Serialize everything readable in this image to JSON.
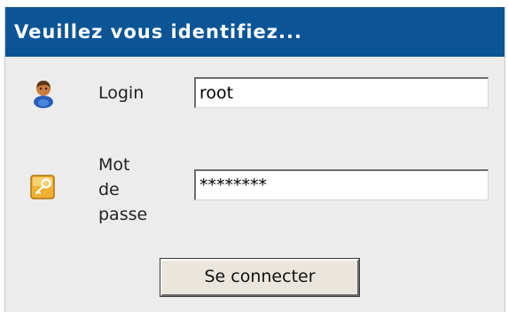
{
  "header": {
    "title": "Veuillez vous identifiez..."
  },
  "form": {
    "login_label": "Login",
    "login_value": "root",
    "login_icon": "user-icon",
    "password_label_lines": [
      "Mot",
      "de",
      "passe"
    ],
    "password_value": "********",
    "password_icon": "key-icon",
    "submit_label": "Se connecter"
  },
  "colors": {
    "title_bar": "#0b5597",
    "panel_background": "#ececec"
  }
}
